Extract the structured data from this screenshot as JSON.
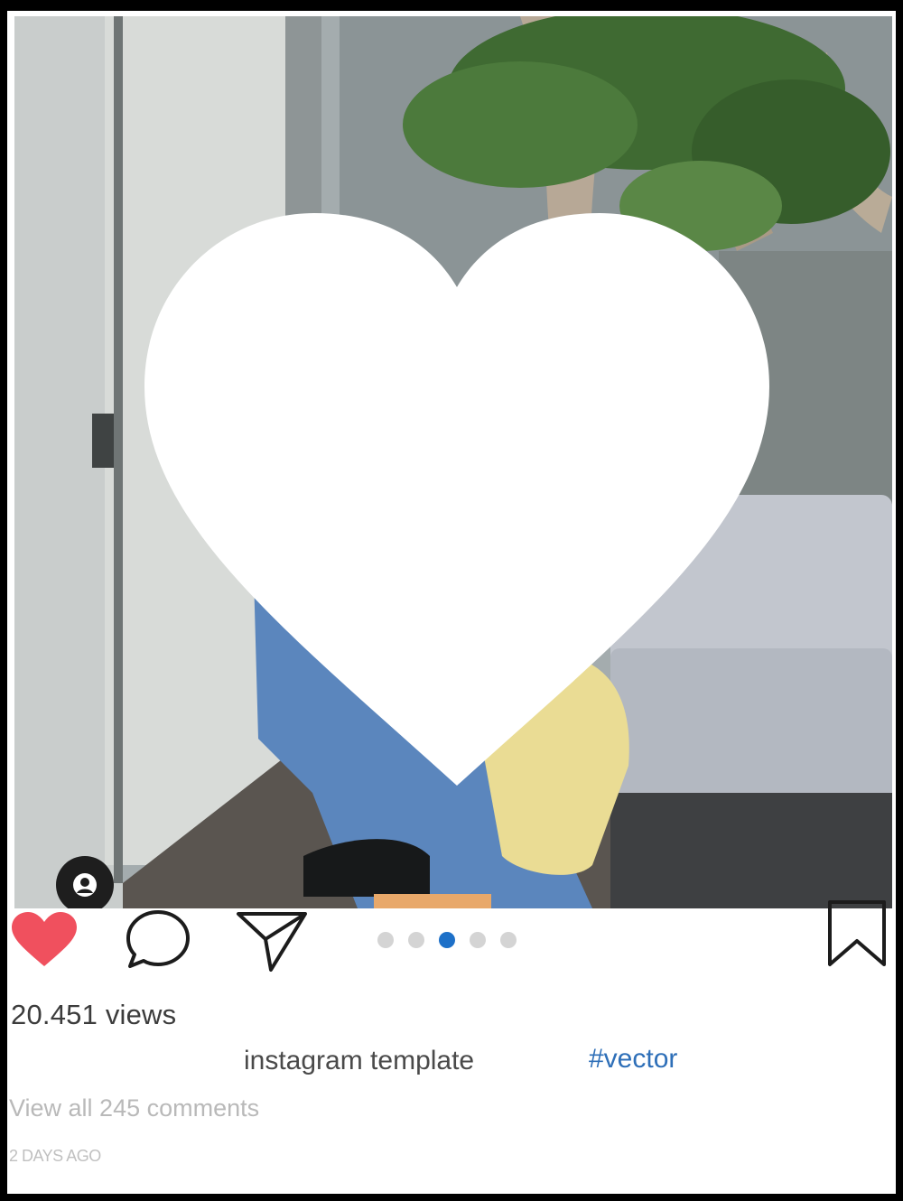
{
  "post": {
    "views_label": "20.451 views",
    "caption": "instagram template",
    "hashtag": "#vector",
    "comments_link": "View all 245 comments",
    "timestamp": "2 DAYS AGO"
  },
  "carousel": {
    "count": 5,
    "active_index": 2
  },
  "icons": {
    "like": "heart-filled-icon",
    "comment": "speech-bubble-icon",
    "share": "paper-plane-icon",
    "save": "bookmark-icon",
    "user_tag": "person-icon",
    "photo_overlay": "heart-icon"
  },
  "colors": {
    "like": "#f0505e",
    "active_dot": "#1d70c8",
    "inactive_dot": "#d4d4d4",
    "hashtag": "#2e6fb8",
    "muted_text": "#b9b9b9"
  }
}
